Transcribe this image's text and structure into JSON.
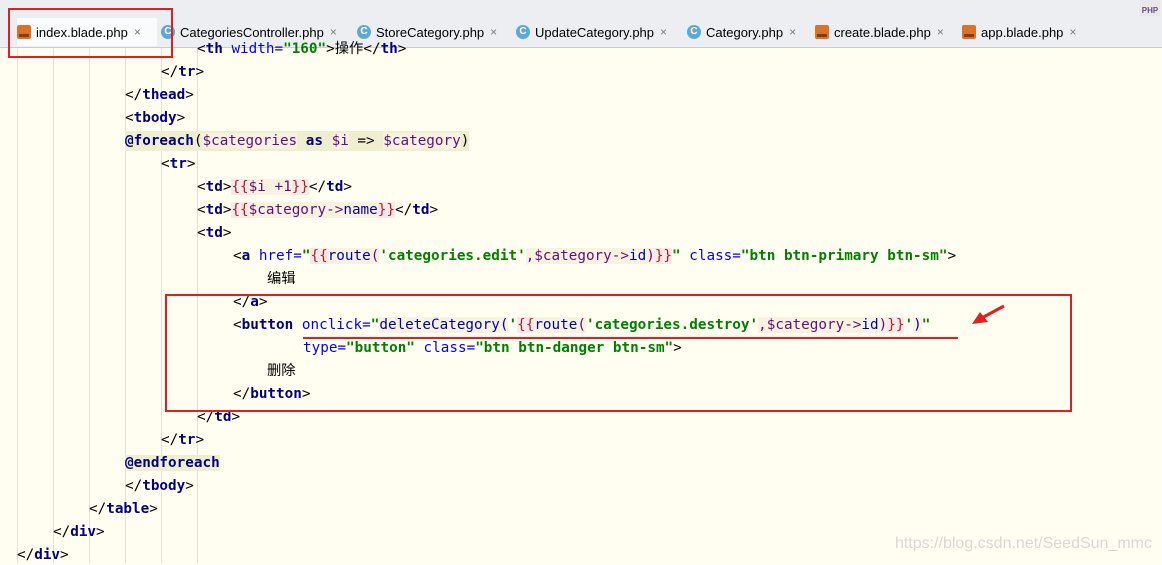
{
  "tabs": [
    {
      "label": "index.blade.php",
      "type": "blade",
      "active": true
    },
    {
      "label": "CategoriesController.php",
      "type": "class",
      "active": false
    },
    {
      "label": "StoreCategory.php",
      "type": "class",
      "active": false
    },
    {
      "label": "UpdateCategory.php",
      "type": "class",
      "active": false
    },
    {
      "label": "Category.php",
      "type": "class",
      "active": false
    },
    {
      "label": "create.blade.php",
      "type": "blade",
      "active": false
    },
    {
      "label": "app.blade.php",
      "type": "blade",
      "active": false
    }
  ],
  "close_glyph": "×",
  "class_icon_letter": "C",
  "php_badge": "PHP",
  "code": {
    "l0": {
      "open": "<",
      "tag": "th",
      "sp": " ",
      "attr": "width",
      "eq": "=",
      "val": "\"160\"",
      "gt": ">",
      "text": "操作",
      "close_open": "</",
      "close_tag": "th",
      "close_gt": ">"
    },
    "l1": {
      "a": "</",
      "b": "tr",
      "c": ">"
    },
    "l2": {
      "a": "</",
      "b": "thead",
      "c": ">"
    },
    "l3": {
      "a": "<",
      "b": "tbody",
      "c": ">"
    },
    "l4": {
      "kw": "@foreach",
      "p1": "(",
      "v1": "$categories",
      "as": " as ",
      "v2": "$i",
      "arrow": " => ",
      "v3": "$category",
      "p2": ")"
    },
    "l5": {
      "a": "<",
      "b": "tr",
      "c": ">"
    },
    "l6": {
      "a": "<",
      "b": "td",
      "c": ">",
      "ob": "{{",
      "v": "$i",
      "rest": " +1",
      "cb": "}}",
      "d": "</",
      "e": "td",
      "f": ">"
    },
    "l7": {
      "a": "<",
      "b": "td",
      "c": ">",
      "ob": "{{",
      "v": "$category",
      "op": "->",
      "prop": "name",
      "cb": "}}",
      "d": "</",
      "e": "td",
      "f": ">"
    },
    "l8": {
      "a": "<",
      "b": "td",
      "c": ">"
    },
    "l9": {
      "a": "<",
      "b": "a",
      "sp": " ",
      "attr1": "href",
      "eq": "=",
      "q1": "\"",
      "ob": "{{",
      "fn": "route",
      "p1": "(",
      "s1": "'categories.edit'",
      "comma": ",",
      "v": "$category",
      "op": "->",
      "prop": "id",
      "p2": ")",
      "cb": "}}",
      "q2": "\"",
      "sp2": " ",
      "attr2": "class",
      "eq2": "=",
      "val2": "\"btn btn-primary btn-sm\"",
      "gt": ">"
    },
    "l10": {
      "text": "编辑"
    },
    "l11": {
      "a": "</",
      "b": "a",
      "c": ">"
    },
    "l12": {
      "a": "<",
      "b": "button",
      "sp": " ",
      "attr": "onclick",
      "eq": "=",
      "q1": "\"",
      "call": "deleteCategory(",
      "q2": "'",
      "ob": "{{",
      "fn": "route",
      "p1": "(",
      "s1": "'categories.destroy'",
      "comma": ",",
      "v": "$category",
      "op": "->",
      "prop": "id",
      "p2": ")",
      "cb": "}}",
      "q3": "'",
      "p3": ")",
      "q4": "\""
    },
    "l13": {
      "attr1": "type",
      "eq": "=",
      "val1": "\"button\"",
      "sp": " ",
      "attr2": "class",
      "eq2": "=",
      "val2": "\"btn btn-danger btn-sm\"",
      "gt": ">"
    },
    "l14": {
      "text": "删除"
    },
    "l15": {
      "a": "</",
      "b": "button",
      "c": ">"
    },
    "l16": {
      "a": "</",
      "b": "td",
      "c": ">"
    },
    "l17": {
      "a": "</",
      "b": "tr",
      "c": ">"
    },
    "l18": {
      "kw": "@endforeach"
    },
    "l19": {
      "a": "</",
      "b": "tbody",
      "c": ">"
    },
    "l20": {
      "a": "</",
      "b": "table",
      "c": ">"
    },
    "l21": {
      "a": "</",
      "b": "div",
      "c": ">"
    },
    "l22": {
      "a": "</",
      "b": "div",
      "c": ">"
    }
  },
  "watermark": "https://blog.csdn.net/SeedSun_mmc",
  "colors": {
    "annotation_red": "#e02020",
    "editor_bg": "#fffef0",
    "tag": "#000080",
    "string": "#008000",
    "attribute": "#0000ff",
    "variable": "#660e7a",
    "blade_brace": "#b22222"
  }
}
